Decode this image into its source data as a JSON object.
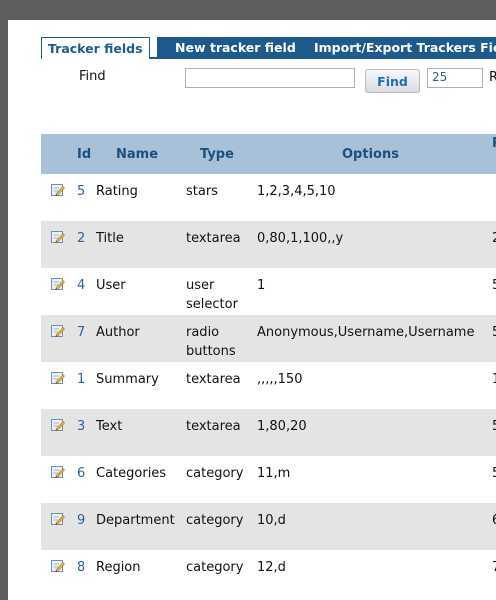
{
  "tabs": [
    {
      "label": "Tracker fields",
      "active": true
    },
    {
      "label": "New tracker field",
      "active": false
    },
    {
      "label": "Import/Export Trackers Fiel",
      "active": false
    }
  ],
  "find": {
    "label": "Find",
    "input_value": "",
    "button_label": "Find",
    "max_records_value": "25",
    "max_records_label": "R"
  },
  "table": {
    "headers": {
      "id": "Id",
      "name": "Name",
      "type": "Type",
      "options": "Options",
      "extra": "P"
    },
    "rows": [
      {
        "id": "5",
        "name": "Rating",
        "type": "stars",
        "options": "1,2,3,4,5,10",
        "extra": ""
      },
      {
        "id": "2",
        "name": "Title",
        "type": "textarea",
        "options": "0,80,1,100,,y",
        "extra": "2"
      },
      {
        "id": "4",
        "name": "User",
        "type": "user selector",
        "options": "1",
        "extra": "5"
      },
      {
        "id": "7",
        "name": "Author",
        "type": "radio buttons",
        "options": "Anonymous,Username,Username",
        "extra": "5"
      },
      {
        "id": "1",
        "name": "Summary",
        "type": "textarea",
        "options": ",,,,,150",
        "extra": "1"
      },
      {
        "id": "3",
        "name": "Text",
        "type": "textarea",
        "options": "1,80,20",
        "extra": "5"
      },
      {
        "id": "6",
        "name": "Categories",
        "type": "category",
        "options": "11,m",
        "extra": "5"
      },
      {
        "id": "9",
        "name": "Department",
        "type": "category",
        "options": "10,d",
        "extra": "6"
      },
      {
        "id": "8",
        "name": "Region",
        "type": "category",
        "options": "12,d",
        "extra": "7"
      }
    ]
  },
  "colors": {
    "accent": "#1d5b8f",
    "header_bg": "#a8c1d8",
    "row_alt": "#e4e4e4",
    "link": "#2a62a3"
  },
  "icons": {
    "edit": "edit-pencil-icon"
  }
}
